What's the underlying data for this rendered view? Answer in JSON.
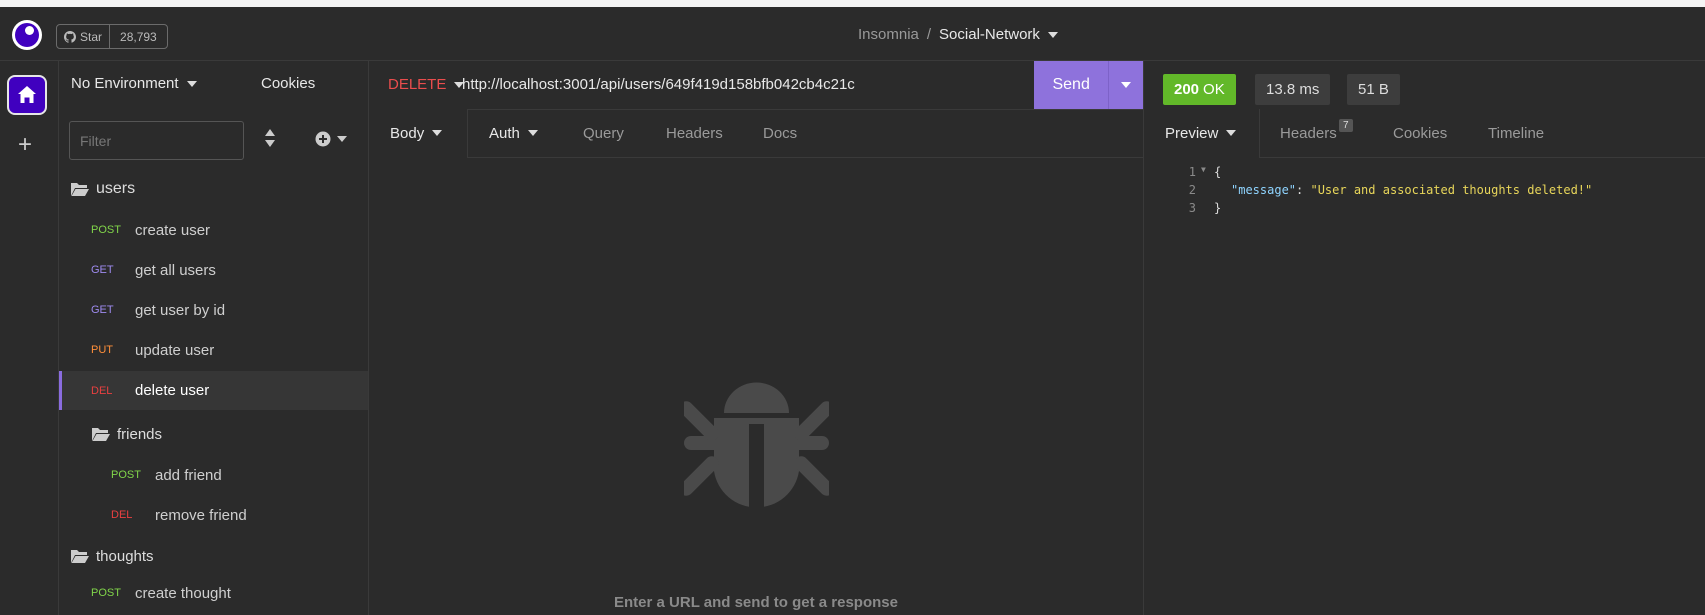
{
  "titlebar": {
    "github_star_label": "Star",
    "github_star_count": "28,793",
    "breadcrumb_app": "Insomnia",
    "breadcrumb_sep": "/",
    "breadcrumb_project": "Social-Network"
  },
  "sidebar": {
    "environment": "No Environment",
    "cookies": "Cookies",
    "filter_placeholder": "Filter",
    "tree": [
      {
        "type": "folder",
        "label": "users"
      },
      {
        "type": "request",
        "method": "POST",
        "label": "create user"
      },
      {
        "type": "request",
        "method": "GET",
        "label": "get all users"
      },
      {
        "type": "request",
        "method": "GET",
        "label": "get user by id"
      },
      {
        "type": "request",
        "method": "PUT",
        "label": "update user"
      },
      {
        "type": "request",
        "method": "DEL",
        "label": "delete user",
        "active": true
      },
      {
        "type": "folder",
        "label": "friends"
      },
      {
        "type": "request",
        "method": "POST",
        "label": "add friend"
      },
      {
        "type": "request",
        "method": "DEL",
        "label": "remove friend"
      },
      {
        "type": "folder",
        "label": "thoughts"
      },
      {
        "type": "request",
        "method": "POST",
        "label": "create thought"
      }
    ]
  },
  "request": {
    "method": "DELETE",
    "url": "http://localhost:3001/api/users/649f419d158bfb042cb4c21c",
    "send_label": "Send",
    "tabs": [
      "Body",
      "Auth",
      "Query",
      "Headers",
      "Docs"
    ],
    "empty_message": "Enter a URL and send to get a response"
  },
  "response": {
    "status_code": "200",
    "status_text": "OK",
    "time": "13.8 ms",
    "size": "51 B",
    "tabs": [
      "Preview",
      "Headers",
      "Cookies",
      "Timeline"
    ],
    "headers_count": "7",
    "lines": [
      {
        "num": "1",
        "text": "{"
      },
      {
        "num": "2",
        "key": "\"message\"",
        "sep": ": ",
        "value": "\"User and associated thoughts deleted!\""
      },
      {
        "num": "3",
        "text": "}"
      }
    ]
  },
  "colors": {
    "accent": "#8e72dc",
    "status_ok": "#62b829",
    "method_post": "#80d44a",
    "method_get": "#9f8bf0",
    "method_put": "#ff8f3a",
    "method_delete": "#e84040"
  }
}
